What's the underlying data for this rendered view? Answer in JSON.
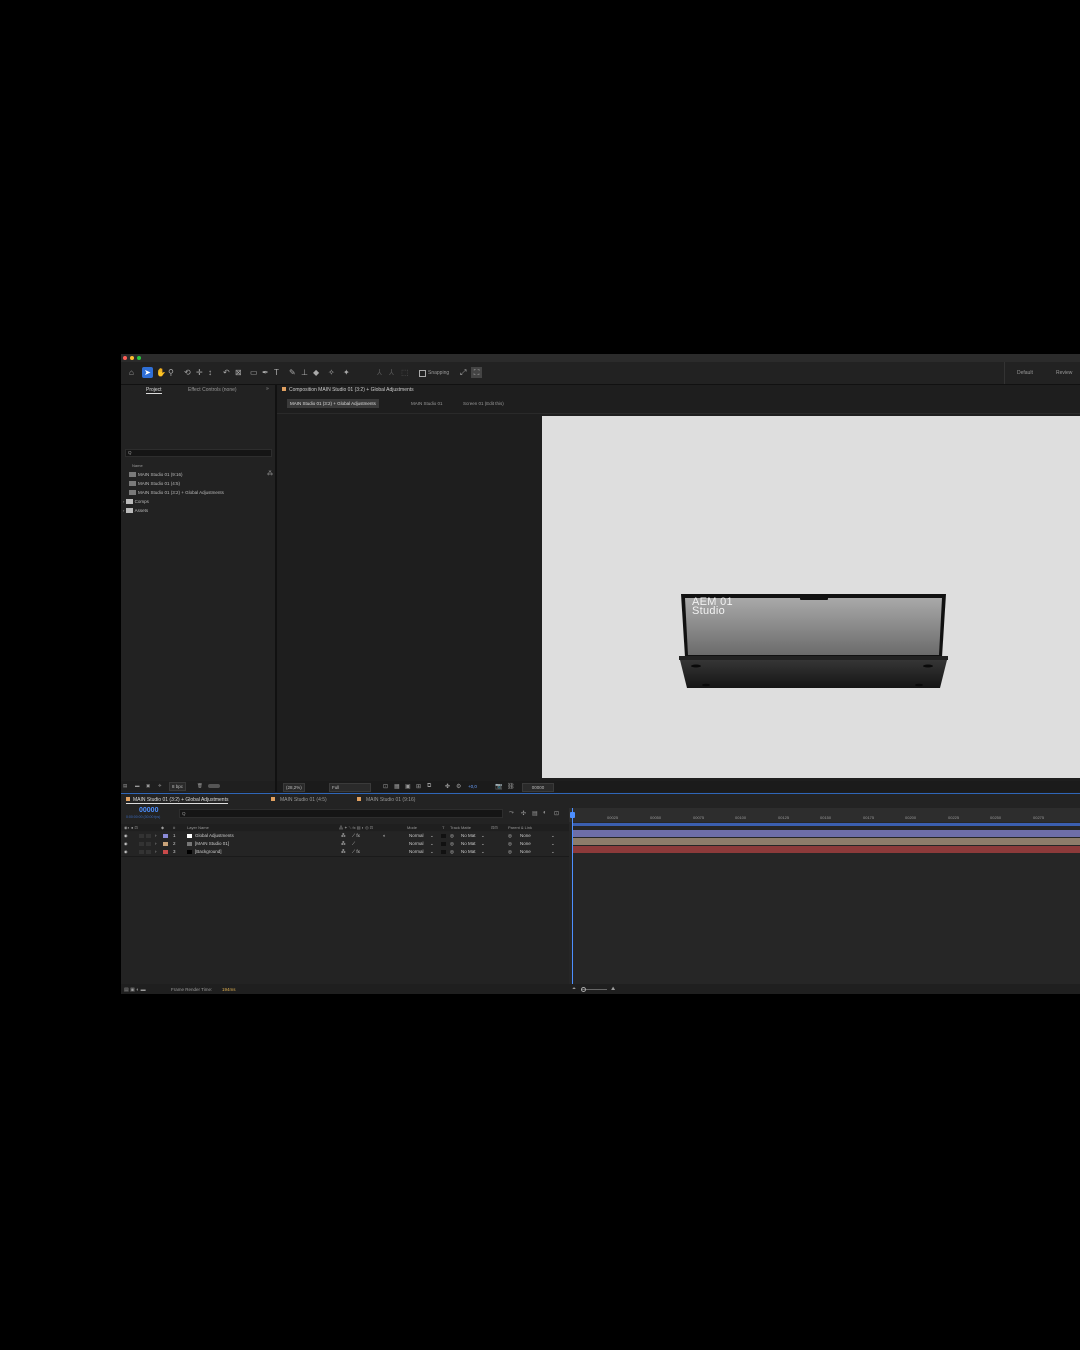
{
  "toolbar": {
    "snapping_label": "Snapping",
    "workspace_default": "Default",
    "workspace_review": "Review"
  },
  "project_panel": {
    "tab_project": "Project",
    "tab_effect_controls": "Effect Controls (none)",
    "search_icon_text": "Q",
    "column_name": "Name",
    "items": [
      {
        "label": "MAIN Studio 01 (9:16)",
        "type": "comp"
      },
      {
        "label": "MAIN Studio 01 (4:5)",
        "type": "comp"
      },
      {
        "label": "MAIN Studio 01 (3:2) + Global Adjustments",
        "type": "comp"
      },
      {
        "label": "Comps",
        "type": "folder"
      },
      {
        "label": "Assets",
        "type": "folder"
      }
    ],
    "bit_depth": "8 bpc"
  },
  "composition_panel": {
    "header": "Composition MAIN Studio 01 (3:2) + Global Adjustments",
    "breadcrumbs": [
      "MAIN Studio 01 (3:2) + Global Adjustments",
      "MAIN Studio 01",
      "Screen 01 (Edit this)"
    ],
    "zoom": "(28,2%)",
    "resolution": "Full",
    "exposure": "+0,0",
    "timecode": "00000"
  },
  "laptop_screen_text": {
    "line1": "AEM 01",
    "line2": "Studio"
  },
  "timeline": {
    "tabs": [
      "MAIN Studio 01 (3:2) + Global Adjustments",
      "MAIN Studio 01 (4:5)",
      "MAIN Studio 01 (9:16)"
    ],
    "current_time": "00000",
    "fps_info": "0:00:00:00 (30.00 fps)",
    "columns": {
      "layer_name": "Layer Name",
      "mode": "Mode",
      "t": "T",
      "track_matte": "Track Matte",
      "parent": "Parent & Link",
      "number": "#"
    },
    "layers": [
      {
        "num": "1",
        "name": "Global Adjustments",
        "mode": "Normal",
        "matte": "No Mat",
        "parent": "None",
        "color": "#8a8ad6"
      },
      {
        "num": "2",
        "name": "[MAIN Studio 01]",
        "mode": "Normal",
        "matte": "No Mat",
        "parent": "None",
        "color": "#c9a37a"
      },
      {
        "num": "3",
        "name": "[Background]",
        "mode": "Normal",
        "matte": "No Mat",
        "parent": "None",
        "color": "#c94a4a"
      }
    ],
    "ruler": [
      "00025",
      "00050",
      "00075",
      "00100",
      "00125",
      "00150",
      "00175",
      "00200",
      "00225",
      "00250",
      "00275"
    ],
    "frame_render_label": "Frame Render Time:",
    "frame_render_value": "194ms"
  }
}
